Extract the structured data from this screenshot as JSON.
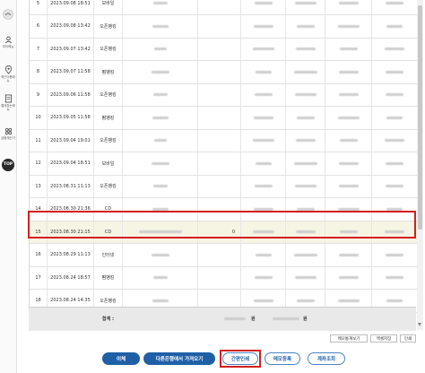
{
  "sidebar": {
    "items": [
      {
        "icon": "user-icon",
        "label": "마이메뉴"
      },
      {
        "icon": "location-pin-icon",
        "label": "최근이용메뉴"
      },
      {
        "icon": "document-icon",
        "label": "즐겨찾는메뉴"
      },
      {
        "icon": "grid-icon",
        "label": "금융계산기"
      }
    ],
    "top_label": "TOP"
  },
  "table": {
    "rows": [
      {
        "no": "5",
        "date": "2023.09.08 18:51",
        "type": "모바일",
        "amount": "",
        "highlighted": false
      },
      {
        "no": "6",
        "date": "2023.09.08 13:42",
        "type": "오픈뱅킹",
        "amount": "",
        "highlighted": false
      },
      {
        "no": "7",
        "date": "2023.09.07 13:42",
        "type": "오픈뱅킹",
        "amount": "",
        "highlighted": false
      },
      {
        "no": "8",
        "date": "2023.09.07 11:58",
        "type": "펌뱅킹",
        "amount": "",
        "highlighted": false
      },
      {
        "no": "9",
        "date": "2023.09.06 11:58",
        "type": "오픈뱅킹",
        "amount": "",
        "highlighted": false
      },
      {
        "no": "10",
        "date": "2023.09.05 11:58",
        "type": "펌뱅킹",
        "amount": "",
        "highlighted": false
      },
      {
        "no": "11",
        "date": "2023.09.04 19:01",
        "type": "오픈뱅킹",
        "amount": "",
        "highlighted": false
      },
      {
        "no": "12",
        "date": "2023.09.04 18:51",
        "type": "모바일",
        "amount": "",
        "highlighted": false
      },
      {
        "no": "13",
        "date": "2023.08.31 11:13",
        "type": "오픈뱅킹",
        "amount": "",
        "highlighted": false
      },
      {
        "no": "14",
        "date": "2023.08.30 21:36",
        "type": "CD",
        "amount": "",
        "highlighted": false
      },
      {
        "no": "15",
        "date": "2023.08.30 21:15",
        "type": "CD",
        "amount": "0",
        "highlighted": true
      },
      {
        "no": "16",
        "date": "2023.08.29 11:13",
        "type": "인터넷",
        "amount": "",
        "highlighted": false
      },
      {
        "no": "17",
        "date": "2023.08.24 18:57",
        "type": "펌뱅킹",
        "amount": "",
        "highlighted": false
      },
      {
        "no": "18",
        "date": "2023.08.24 14:35",
        "type": "오픈뱅킹",
        "amount": "",
        "highlighted": false
      }
    ],
    "summary": {
      "label": "합계 :",
      "unit1": "원",
      "unit2": "원"
    }
  },
  "small_buttons": {
    "memo_stats": "메모통계보기",
    "excel_save": "엑셀저장",
    "print": "인쇄"
  },
  "actions": {
    "transfer": "이체",
    "other_bank": "다른은행에서 가져오기",
    "simple_print": "간편인쇄",
    "memo_register": "메모등록",
    "account_inquiry": "계좌조회"
  },
  "colors": {
    "primary_blue": "#1f5fa6",
    "highlight_row": "#f6f5e4",
    "annotation_red": "#d31f1f"
  }
}
